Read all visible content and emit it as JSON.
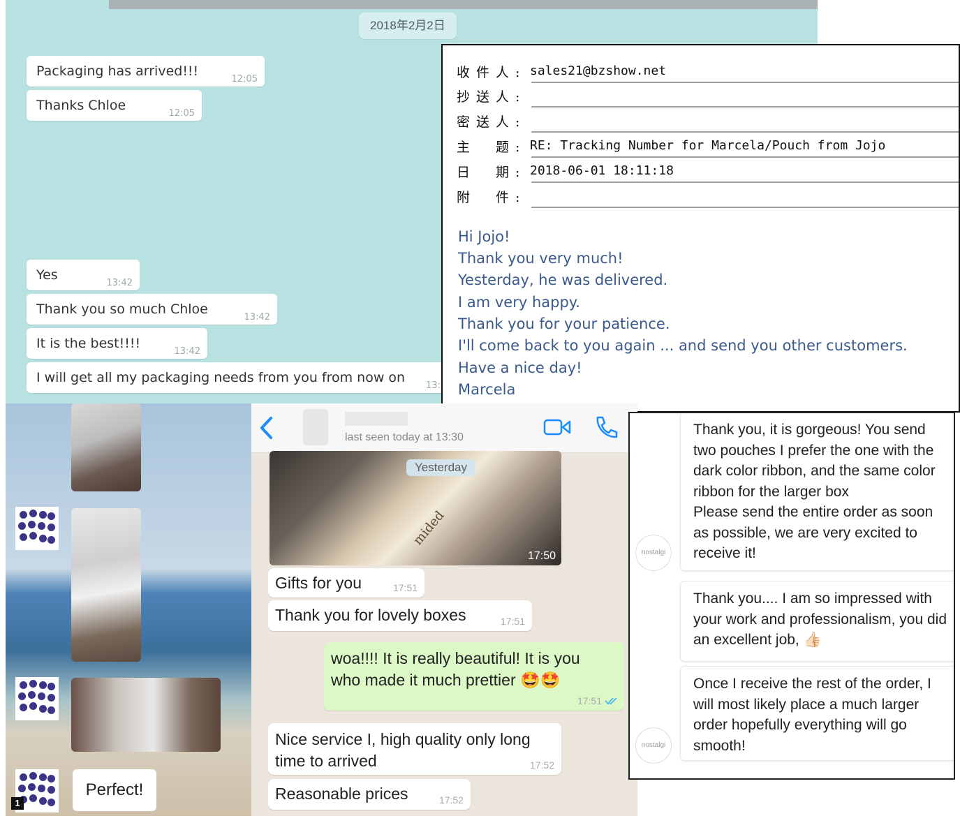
{
  "chat": {
    "date": "2018年2月2日",
    "messages": [
      {
        "text": "Packaging has arrived!!!",
        "time": "12:05"
      },
      {
        "text": "Thanks Chloe",
        "time": "12:05"
      },
      {
        "text": "Yes",
        "time": "13:42"
      },
      {
        "text": "Thank you so much Chloe",
        "time": "13:42"
      },
      {
        "text": "It is the best!!!!",
        "time": "13:42"
      },
      {
        "text": "I will get all my packaging needs from you from now on",
        "time": "13:"
      }
    ]
  },
  "email": {
    "header": [
      {
        "label": "收件人:",
        "value": "sales21@bzshow.net"
      },
      {
        "label": "抄送人:",
        "value": ""
      },
      {
        "label": "密送人:",
        "value": ""
      },
      {
        "label": "主　题:",
        "value": "RE: Tracking Number for Marcela/Pouch from Jojo"
      },
      {
        "label": "日　期:",
        "value": "2018-06-01 18:11:18"
      },
      {
        "label": "附　件:",
        "value": ""
      }
    ],
    "body": [
      "Hi Jojo!",
      "Thank you very much!",
      "Yesterday, he was delivered.",
      "I am very happy.",
      "Thank you for your patience.",
      "I'll come back to you again ... and send you other customers.",
      "Have a nice day!",
      "Marcela"
    ]
  },
  "instagram": {
    "message": "Perfect!",
    "badge": "1"
  },
  "whatsapp": {
    "last_seen": "last seen today at 13:30",
    "day_chip": "Yesterday",
    "image_time": "17:50",
    "image_caption": "mided",
    "messages": [
      {
        "text": "Gifts for you",
        "time": "17:51",
        "outgoing": false
      },
      {
        "text": "Thank you for lovely boxes",
        "time": "17:51",
        "outgoing": false
      },
      {
        "text": "woa!!!! It is really beautiful!   It is you who made it much prettier 🤩🤩",
        "time": "17:51",
        "outgoing": true
      },
      {
        "text": "Nice service I, high quality only long time to arrived",
        "time": "17:52",
        "outgoing": false
      },
      {
        "text": "Reasonable prices",
        "time": "17:52",
        "outgoing": false
      }
    ],
    "icons": [
      "back-chevron-icon",
      "video-call-icon",
      "phone-icon"
    ],
    "colors": {
      "accent": "#1a8cff",
      "outgoing_bubble": "#dcf8c6",
      "background": "#ece5dd"
    }
  },
  "reviews": {
    "avatar_label": "nostalgi",
    "items": [
      {
        "text": "Thank you, it is gorgeous! You send two pouches I prefer the one with the dark color ribbon, and the same color ribbon for the larger box\nPlease send the entire order as soon as possible, we are very excited to receive it!"
      },
      {
        "text": "Thank you.... I am so impressed with your work and professionalism, you did an excellent job, 👍🏻"
      },
      {
        "text": "Once I receive the rest of the order, I will most likely place a much larger order hopefully everything will go smooth!"
      }
    ]
  }
}
